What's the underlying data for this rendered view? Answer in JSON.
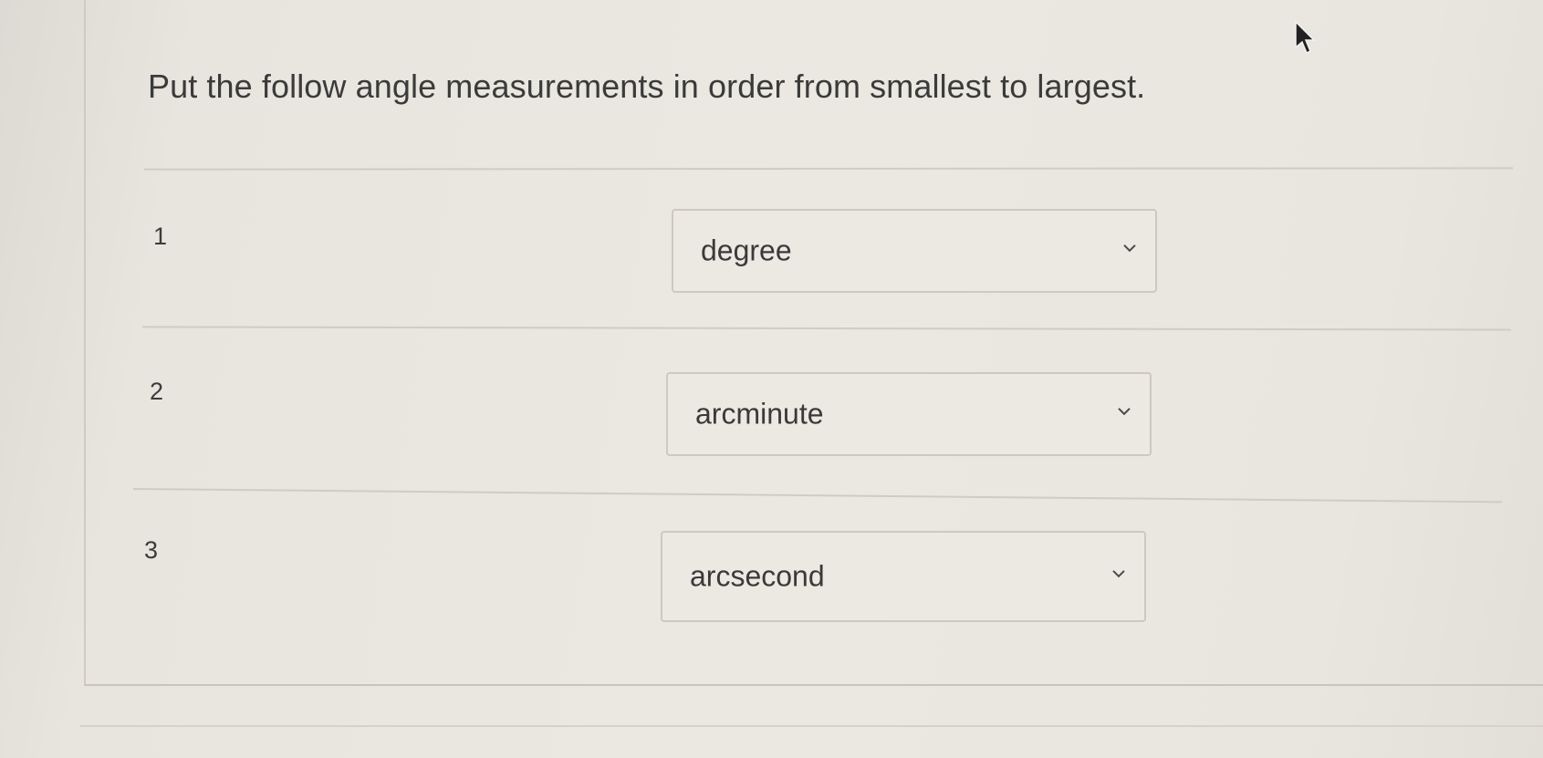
{
  "question": {
    "text": "Put the follow angle measurements in order from smallest to largest."
  },
  "rows": [
    {
      "number": "1",
      "selected": "degree"
    },
    {
      "number": "2",
      "selected": "arcminute"
    },
    {
      "number": "3",
      "selected": "arcsecond"
    }
  ],
  "icons": {
    "dropdown": "chevron-down-icon",
    "pointer": "mouse-cursor-icon"
  },
  "colors": {
    "background": "#e9e6df",
    "text": "#3a3a3a",
    "border": "#cdc9c0"
  }
}
